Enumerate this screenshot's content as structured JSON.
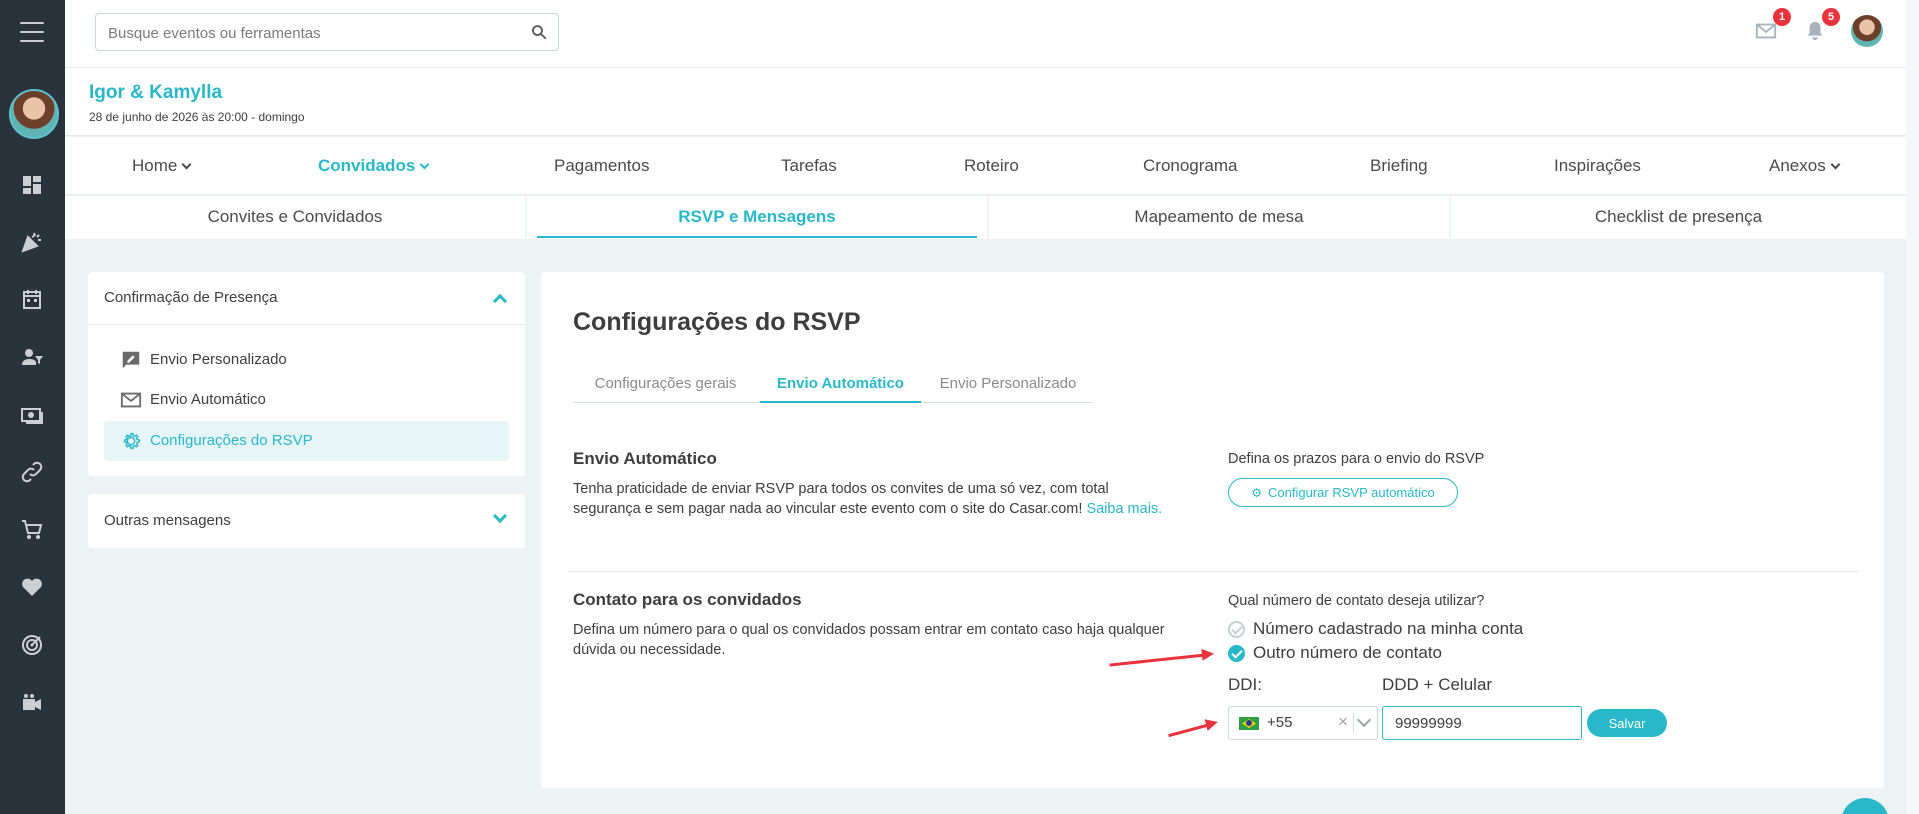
{
  "search": {
    "placeholder": "Busque eventos ou ferramentas"
  },
  "topbar": {
    "mail_badge": "1",
    "bell_badge": "5"
  },
  "event": {
    "name": "Igor & Kamylla",
    "date": "28 de junho de 2026 às 20:00 - domingo"
  },
  "mainnav": [
    {
      "label": "Home"
    },
    {
      "label": "Convidados"
    },
    {
      "label": "Pagamentos"
    },
    {
      "label": "Tarefas"
    },
    {
      "label": "Roteiro"
    },
    {
      "label": "Cronograma"
    },
    {
      "label": "Briefing"
    },
    {
      "label": "Inspirações"
    },
    {
      "label": "Anexos"
    }
  ],
  "subnav": [
    {
      "label": "Convites e Convidados"
    },
    {
      "label": "RSVP e Mensagens"
    },
    {
      "label": "Mapeamento de mesa"
    },
    {
      "label": "Checklist de presença"
    }
  ],
  "sidebar": {
    "group1": {
      "title": "Confirmação de Presença",
      "items": [
        {
          "label": "Envio Personalizado"
        },
        {
          "label": "Envio Automático"
        },
        {
          "label": "Configurações do RSVP"
        }
      ]
    },
    "group2": {
      "title": "Outras mensagens"
    }
  },
  "card": {
    "title": "Configurações do RSVP",
    "tabs": [
      {
        "label": "Configurações gerais"
      },
      {
        "label": "Envio Automático"
      },
      {
        "label": "Envio Personalizado"
      }
    ],
    "auto": {
      "heading": "Envio Automático",
      "text": "Tenha praticidade de enviar RSVP para todos os convites de uma só vez, com total segurança e sem pagar nada ao vincular este evento com o site do Casar.com!",
      "link": "Saiba mais.",
      "deadline_label": "Defina os prazos para o envio do RSVP",
      "config_button": "Configurar RSVP automático"
    },
    "contact": {
      "heading": "Contato para os convidados",
      "text": "Defina um número para o qual os convidados possam entrar em contato caso haja qualquer dúvida ou necessidade.",
      "question": "Qual número de contato deseja utilizar?",
      "option1": "Número cadastrado na minha conta",
      "option2": "Outro número de contato",
      "ddi_label": "DDI:",
      "phone_label": "DDD + Celular",
      "ddi_value": "+55",
      "phone_value": "99999999",
      "save_button": "Salvar"
    }
  },
  "colors": {
    "accent": "#29b8c9",
    "rail": "#2a333c",
    "badge": "#e8333c",
    "arrow": "#e8333c"
  }
}
